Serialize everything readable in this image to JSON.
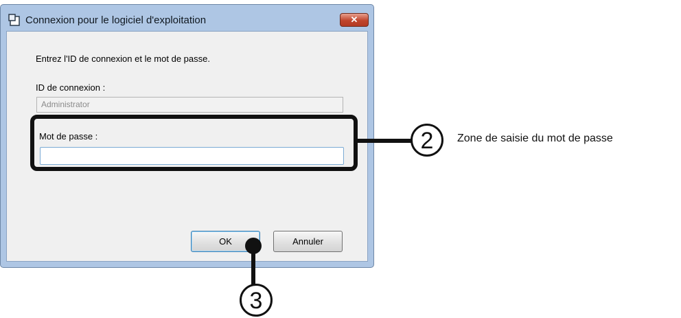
{
  "dialog": {
    "title": "Connexion pour le logiciel d'exploitation",
    "close_label": "✕",
    "instruction": "Entrez l'ID de connexion et le mot de passe.",
    "id_label": "ID de connexion :",
    "id_value": "Administrator",
    "password_label": "Mot de passe :",
    "password_value": "",
    "ok_label": "OK",
    "cancel_label": "Annuler"
  },
  "annotations": {
    "callout_2_number": "2",
    "callout_2_text": "Zone de saisie du mot de passe",
    "callout_3_number": "3"
  },
  "colors": {
    "frame": "#aec6e4",
    "close_button": "#c0452c",
    "annotation": "#111111"
  }
}
